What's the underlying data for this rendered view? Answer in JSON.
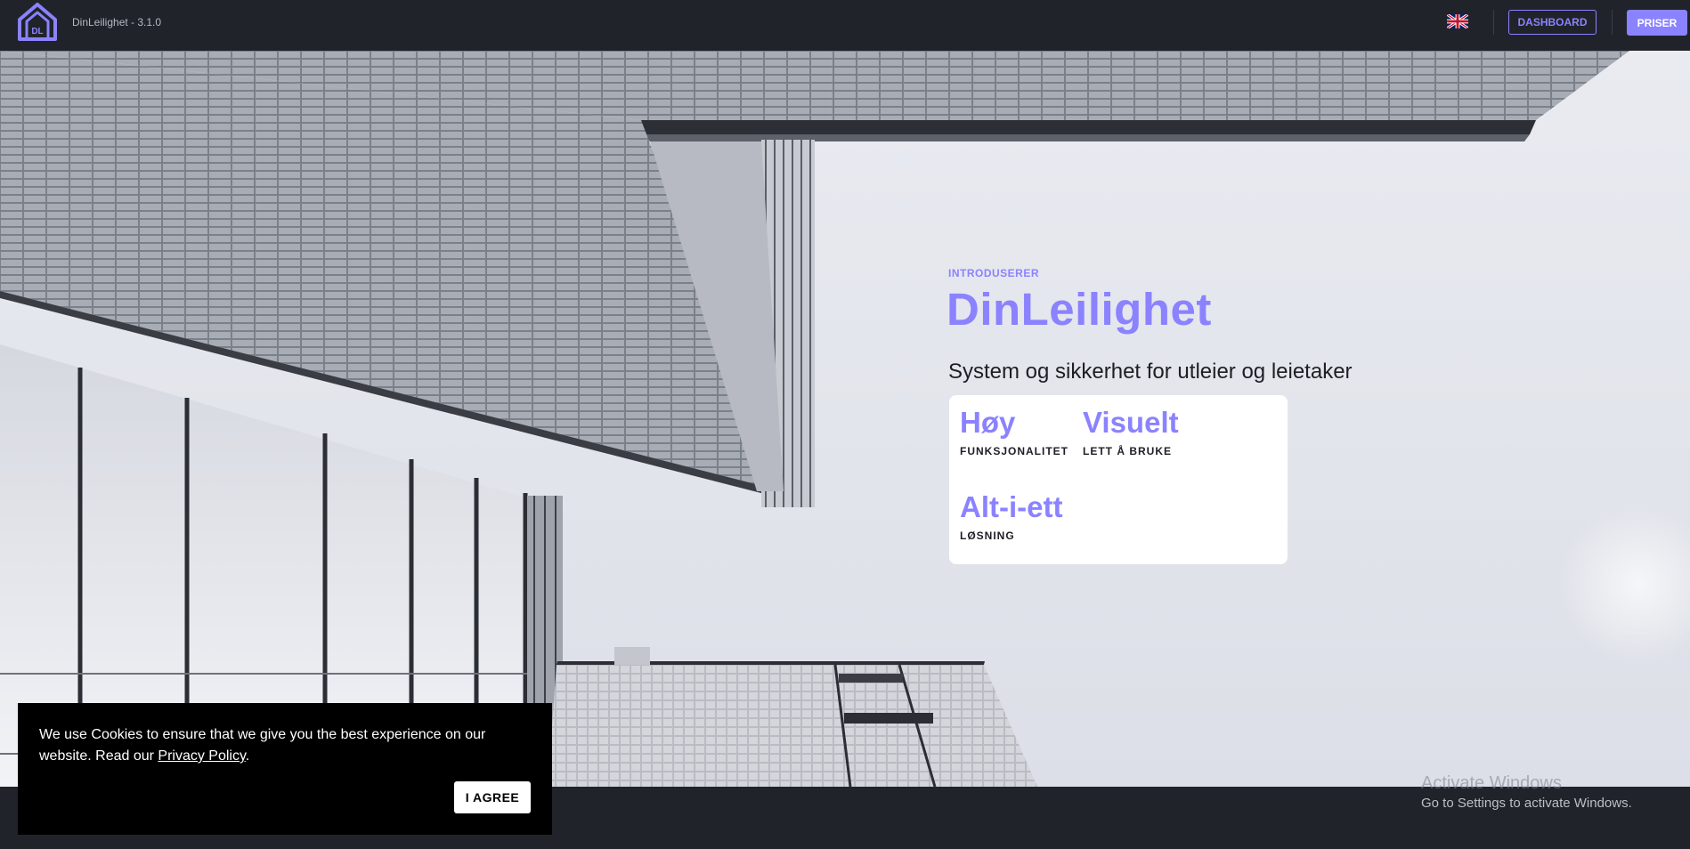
{
  "header": {
    "app_title": "DinLeilighet - 3.1.0",
    "logo_text": "DL",
    "language_flag_icon": "uk-flag-icon",
    "dashboard_label": "DASHBOARD",
    "priser_label": "PRISER"
  },
  "hero": {
    "intro_label": "INTRODUSERER",
    "brand_name": "DinLeilighet",
    "tagline": "System og sikkerhet for utleier og leietaker",
    "features": [
      {
        "title": "Høy",
        "subtitle": "FUNKSJONALITET"
      },
      {
        "title": "Visuelt",
        "subtitle": "LETT Å BRUKE"
      },
      {
        "title": "Alt-i-ett",
        "subtitle": "LØSNING"
      }
    ]
  },
  "cookie_banner": {
    "text_before": "We use Cookies to ensure that we give you the best experience on our website. Read our ",
    "link_label": "Privacy Policy",
    "text_after": ".",
    "agree_label": "I AGREE"
  },
  "watermark": {
    "title": "Activate Windows",
    "subtitle": "Go to Settings to activate Windows."
  },
  "colors": {
    "accent": "#8b82ff",
    "header_bg": "#20232a",
    "cookie_bg": "#000000",
    "text_dark": "#1d1f25"
  }
}
